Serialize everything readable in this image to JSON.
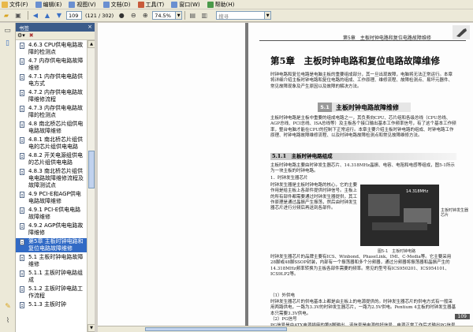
{
  "menubar": {
    "items": [
      {
        "label": "文件(F)",
        "icon": "file-icon",
        "color": "#e8b84a"
      },
      {
        "label": "编辑(E)",
        "icon": "edit-icon",
        "color": "#6a8fd0"
      },
      {
        "label": "视图(V)",
        "icon": "view-icon",
        "color": "#6a8fd0"
      },
      {
        "label": "文档(D)",
        "icon": "document-icon",
        "color": "#6a8fd0"
      },
      {
        "label": "工具(T)",
        "icon": "tools-icon",
        "color": "#c85a3a"
      },
      {
        "label": "窗口(W)",
        "icon": "window-icon",
        "color": "#6a8fd0"
      },
      {
        "label": "帮助(H)",
        "icon": "help-icon",
        "color": "#4a9a4a"
      }
    ]
  },
  "toolbar": {
    "page_input": "109",
    "page_count": "(121 / 302)",
    "zoom": "74.5%",
    "search_placeholder": "搜寻"
  },
  "bookmarks": {
    "title": "书签",
    "items": [
      "4.6.3 CPU供电电路故障的检测点",
      "4.7 内存供电电路故障维修",
      "4.7.1 内存供电电路供电方式",
      "4.7.2 内存供电电路故障维修流程",
      "4.7.3 内存供电电路故障的检测点",
      "4.8 南北桥芯片组供电电路故障维修",
      "4.8.1 南北桥芯片组供电的芯片组供电电路",
      "4.8.2 开关电源组供电的芯片组供电电路",
      "4.8.3 南北桥芯片组供电电路故障维修流程及故障测试点",
      "4.9 PCI-E和AGP供电电路故障维修",
      "4.9.1 PCI-E供电电路故障维修",
      "4.9.2 AGP供电电路故障维修",
      "第5章 主板时钟电路和复位电路故障维修",
      "5.1 主板时钟电路故障维修",
      "5.1.1 主板时钟电路组成",
      "5.1.2 主板时钟电路工作流程",
      "5.1.3 主板时钟"
    ],
    "selected_index": 12
  },
  "page": {
    "header": "第5章　主板时钟电路和复位电路故障维修",
    "chapter_title": "第5章　主板时钟电路和复位电路故障维修",
    "intro": "时钟电路和复位电路是电脑主板的重要组成部分，其一旦出现故障，电脑将无法正常运行。本章将详细介绍主板时钟电路和复位电路的组成、工作原理、维修流程、故障检测点、易坏元器件、常见故障现象及产生原因以及故障的解决方法。",
    "section_num": "5.1",
    "section_title": "主板时钟电路故障维修",
    "section_text": "主板时钟电路是主板中重要的组成电路之一，其负责向CPU、芯片组和各级总线（CPU总线、AGP总线、PCI总线、ISA总线等）及主板各个接口输出基本工作频率信号，有了这个基本工作频率，整台电脑才能在CPU的控制下正常运行。本章主要介绍主板时钟电路的组成、时钟电路工作原理、时钟电路故障维修流程、以及时钟电路故障检测点和常见故障维修方法。",
    "subsection_title": "5.1.1　主板时钟电路组成",
    "subsection_text": "主板时钟电路主要由时钟发生器芯片、14.318MHz晶振、电容、电阻和电感等组成，图5-1所示为一块主板的时钟电路。",
    "item1": "1．时钟发生器芯片",
    "item1_text": "时钟发生器是主板时钟电路的核心，它的主要作用是给主板上各部件提供时钟信号。主板上的所有部件都需要通过时钟发生器提供，其工作原理是通过晶振产生振荡，然后由时钟发生器芯片进行分频后再送到各部件。",
    "item1_text2": "时钟发生器芯片的品牌主要有ICS、Winbond、PhaseLink、IMI、C-Media等。它主要采用28脚或48脚SSOP封装，内部有一个振荡器和多个分频器，通过分频器将振荡器和晶振产生的14.318MHz频率转换为主板各部件需要的频率。常见的型号有ICS950201、ICS954101、ICS9LP2等。",
    "sub_a": "（1）外供电",
    "sub_a_text": "时钟发生器芯片的供电基本上都是由主板上的电源提供的。时钟发生器芯片的供电方式有一般采用两路供电，一路为3.3V的时钟发生器芯片，一路为2.5V供电。Pentium 4主板的时钟发生器基本只需要3.3V供电。",
    "sub_b": "（2）PG信号",
    "sub_b_text": "PG信号是由ATX电源插座的第8脚输出，该信号是电源的好信号，电源正常工作后才输出PG信号到主板。",
    "figure_caption": "图5-1　主板时钟电路",
    "side_annotation": "主板时钟发生器芯片",
    "chip_label": "14.318MHz",
    "page_number": "109"
  }
}
